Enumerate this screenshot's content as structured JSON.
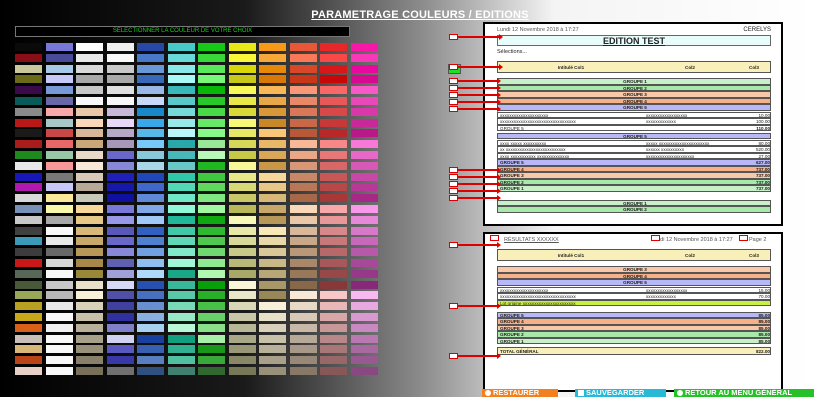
{
  "page": {
    "title": "PARAMETRAGE COULEURS / EDITIONS",
    "select_label": "SELECTIONNER LA COULEUR DE VOTRE CHOIX"
  },
  "palette": [
    [
      "#0a0a0a",
      "#8a0e18",
      "#c8c89a",
      "#6a6a18",
      "#3a0a4a",
      "#0a5a5a",
      "#8a8a8a",
      "#b81818",
      "#1a1a1a",
      "#a81c1c",
      "#1e8a1e",
      "#e8e8e8",
      "#1818b8",
      "#b018b0",
      "#d8d8d8",
      "#7890b8",
      "#c8c8c8",
      "#404040",
      "#3a9ab8",
      "#3c3c3c",
      "#c81818",
      "#586858",
      "#485838",
      "#98a858",
      "#b8a020",
      "#c8a818",
      "#d86018",
      "#c8c0b8",
      "#d8b878",
      "#b84418",
      "#e8d0c8"
    ],
    [
      "#7878d8",
      "#4a4a9a",
      "#a8c8e8",
      "#c8c8f8",
      "#7898d8",
      "#6868a8",
      "#f8a8a8",
      "#a8c8c8",
      "#c84848",
      "#e86868",
      "#98c8a8",
      "#f89898",
      "#787878",
      "#c8c8f8",
      "#f8e898",
      "#f8f8a8",
      "#a8a8a8",
      "#f8f8f8",
      "#e8e8e8",
      "#686868",
      "#d8d8d8",
      "#f8f8f8",
      "#c8c8c8",
      "#b8b8b8",
      "#e8e8e8",
      "#f8f8f8",
      "#f0f0f0",
      "#f8f8f8",
      "#f8f8f8",
      "#f8f8f8",
      "#f8f8f8"
    ],
    [
      "#ffffff",
      "#e8e8e8",
      "#d8d8d8",
      "#a8a8a8",
      "#c8c8c8",
      "#f8f8f8",
      "#e8c8a8",
      "#f8d8b8",
      "#d8b898",
      "#c8a878",
      "#e8d8c8",
      "#f8e8d8",
      "#d8c8b8",
      "#b8a898",
      "#c8c8b8",
      "#f8d898",
      "#e8c888",
      "#d8b878",
      "#c8a868",
      "#b89858",
      "#a88848",
      "#988838",
      "#e8e0c8",
      "#f8f0d8",
      "#d8d0b8",
      "#c8c0a8",
      "#b8b098",
      "#a8a088",
      "#989078",
      "#888068",
      "#787058"
    ],
    [
      "#f0f0f0",
      "#f8f8f8",
      "#c8c8c8",
      "#a8a8a8",
      "#e0e0e0",
      "#f8f8f8",
      "#c8b8d8",
      "#e8d8f8",
      "#b8a8c8",
      "#a898b8",
      "#6868c8",
      "#8888d8",
      "#2020b8",
      "#1818a8",
      "#1010a0",
      "#7878d8",
      "#9898e8",
      "#5858b8",
      "#6868c8",
      "#8888d8",
      "#6060b0",
      "#a0a0d8",
      "#d8d8f8",
      "#5050a8",
      "#4040a0",
      "#3030a0",
      "#8080c8",
      "#d0d0f0",
      "#5858c0",
      "#3838a8",
      "#707070"
    ],
    [
      "#2848a8",
      "#4878c8",
      "#6898d8",
      "#3868b8",
      "#98b8e8",
      "#c8d8f8",
      "#1888c8",
      "#38a8e8",
      "#58b8e8",
      "#78c8f8",
      "#88c8d8",
      "#a8d8e8",
      "#2048b8",
      "#4068c8",
      "#6088d8",
      "#80a8e8",
      "#a0c8f8",
      "#3060c0",
      "#5080d0",
      "#70a0e0",
      "#90c0f0",
      "#b0d8f8",
      "#2850b0",
      "#4870c0",
      "#6890d0",
      "#88b0e0",
      "#a8d0f0",
      "#1840a0",
      "#3860b0",
      "#5880c0",
      "#305080"
    ],
    [
      "#48c8c8",
      "#68d8d8",
      "#88e8e8",
      "#a8f8f8",
      "#38b8b8",
      "#58c8c8",
      "#78d8d8",
      "#98e8e8",
      "#b8f8f8",
      "#28a8a8",
      "#48b8b8",
      "#68c8c8",
      "#30c8a8",
      "#50d8b8",
      "#70e8c8",
      "#90f8d8",
      "#20b898",
      "#40c8a8",
      "#60d8b8",
      "#80e8c8",
      "#a0f8d8",
      "#18a888",
      "#38b898",
      "#58c8a8",
      "#78d8b8",
      "#98e8c8",
      "#b8f8d8",
      "#10a080",
      "#30b090",
      "#50c0a0",
      "#408070"
    ],
    [
      "#18c818",
      "#38d838",
      "#58e858",
      "#78f878",
      "#08b808",
      "#28c828",
      "#48d848",
      "#68e868",
      "#88f888",
      "#98e898",
      "#b8f8b8",
      "#20b820",
      "#40c840",
      "#60d860",
      "#80e880",
      "#a0f8a0",
      "#10a810",
      "#30b830",
      "#50c850",
      "#70d870",
      "#90e890",
      "#b0f8b0",
      "#08a008",
      "#28b028",
      "#48c048",
      "#68d068",
      "#88e088",
      "#a8f0a8",
      "#189818",
      "#38a838",
      "#306830"
    ],
    [
      "#e8e818",
      "#f8f838",
      "#d8d808",
      "#c8c818",
      "#f8f858",
      "#e8e848",
      "#d8d838",
      "#f8f878",
      "#e8e868",
      "#d8d858",
      "#c8c848",
      "#f8f898",
      "#e8e888",
      "#d8d878",
      "#c8c868",
      "#b8b858",
      "#f8f8b8",
      "#e8e8a8",
      "#d8d898",
      "#c8c888",
      "#b8b878",
      "#a8a868",
      "#f8f8d8",
      "#e8e8c8",
      "#d8d8b8",
      "#c8c8a8",
      "#b8b898",
      "#a8a888",
      "#989878",
      "#888868",
      "#787858"
    ],
    [
      "#f89818",
      "#f8a838",
      "#e88808",
      "#d87808",
      "#f8b858",
      "#e8a848",
      "#d89838",
      "#c88828",
      "#f8c878",
      "#e8b868",
      "#d8a858",
      "#c89848",
      "#f8d898",
      "#e8c888",
      "#d8b878",
      "#c8a868",
      "#b89858",
      "#f8e8b8",
      "#e8d8a8",
      "#d8c898",
      "#c8b888",
      "#b8a878",
      "#a89868",
      "#988858",
      "#f8f0d8",
      "#e8e0c8",
      "#d8d0b8",
      "#c8c0a8",
      "#b8b098",
      "#a8a088",
      "#989078"
    ],
    [
      "#e85838",
      "#f87858",
      "#d84828",
      "#c83818",
      "#f89878",
      "#e88868",
      "#d87858",
      "#c86848",
      "#b85838",
      "#f8b898",
      "#e8a888",
      "#d89878",
      "#c88868",
      "#b87858",
      "#a86848",
      "#f8d8b8",
      "#e8c8a8",
      "#d8b898",
      "#c8a888",
      "#b89878",
      "#a88868",
      "#987858",
      "#886848",
      "#f8e8d8",
      "#e8d8c8",
      "#d8c8b8",
      "#c8b8a8",
      "#b8a898",
      "#a89888",
      "#988878",
      "#887868"
    ],
    [
      "#e82828",
      "#f84848",
      "#d81818",
      "#c80808",
      "#f86868",
      "#e85858",
      "#d84848",
      "#c83838",
      "#b82828",
      "#f88888",
      "#e87878",
      "#d86868",
      "#c85858",
      "#b84848",
      "#a83838",
      "#f8a8a8",
      "#e89898",
      "#d88888",
      "#c87878",
      "#b86868",
      "#a85858",
      "#984848",
      "#883838",
      "#f8c8c8",
      "#e8b8b8",
      "#d8a8a8",
      "#c89898",
      "#b88888",
      "#a87878",
      "#986868",
      "#885858"
    ],
    [
      "#f818a8",
      "#f838b8",
      "#e808a0",
      "#d80890",
      "#f858c8",
      "#e848b8",
      "#d838a8",
      "#c82898",
      "#b81888",
      "#f878d8",
      "#e868c8",
      "#d858b8",
      "#c848a8",
      "#b83898",
      "#a82888",
      "#f898e8",
      "#e888d8",
      "#d878c8",
      "#c868b8",
      "#b858a8",
      "#a84898",
      "#983888",
      "#882878",
      "#f8b8f0",
      "#e8a8e0",
      "#d898d0",
      "#c888c0",
      "#b878b0",
      "#a868a0",
      "#985890",
      "#884880"
    ]
  ],
  "report1": {
    "date": "Lundi 12 Novembre 2018 à 17:27",
    "company": "CERELYS",
    "title": "EDITION TEST",
    "selections": "Sélections...",
    "col1": "Intitulé Col1",
    "col2": "Col2",
    "col3": "Col3",
    "groups_top": [
      "GROUPE 1",
      "GROUPE 2",
      "GROUPE 3",
      "GROUPE 4",
      "GROUPE 5"
    ],
    "lines_a": [
      [
        "xxxxxxxxxxxxxxxxxxxxx",
        "xxxxxxxxxxxxxxxxxx",
        "10.00"
      ],
      [
        "xxxxxxxxxxxxxxxxxxxxxxxxxxxxxxxxx",
        "xxxxxxxxxxxxx",
        "100.00"
      ]
    ],
    "subtotal_a": [
      "GROUPE 5",
      "",
      "110.00"
    ],
    "group_mid": "GROUPE 5",
    "lines_b": [
      [
        "xxxx xxxxx xxxxxxxxxx",
        "xxxxx xxxxxxxxxxxxxxxxxxxxxx",
        "80.00"
      ],
      [
        "xx xxxxxxxxxxxxxxxxxxxxxxxxxx",
        "xxxxxx xxxxxxxxxx",
        "520.00"
      ],
      [
        "xxxx xxxxxxxxxxx xxxxxxxxxxxxxx",
        "xxxxxxxxxxxxxxxxxxxxx",
        "27.00"
      ]
    ],
    "totals": [
      [
        "GROUPE 5",
        "627.00"
      ],
      [
        "GROUPE 4",
        "737.00"
      ],
      [
        "GROUPE 3",
        "737.00"
      ],
      [
        "GROUPE 2",
        "737.00"
      ],
      [
        "GROUPE 1",
        "737.00"
      ]
    ],
    "groups_bottom": [
      "GROUPE 1",
      "GROUPE 2"
    ]
  },
  "report2": {
    "header_left": "RÉSULTATS XXXXXX",
    "date": "Lundi 12 Novembre 2018 à 17:27",
    "page": "Page 2",
    "col1": "Intitulé Col1",
    "col2": "Col2",
    "col3": "Col3",
    "groups": [
      "GROUPE 3",
      "GROUPE 4",
      "GROUPE 5"
    ],
    "lines": [
      [
        "xxxxxxxxxxxxxxxxxxxxx",
        "xxxxxxxxxxxxxxxxxx",
        "15.00"
      ],
      [
        "xxxxxxxxxxxxxxxxxxxxxxxxxxxxxxxxx",
        "xxxxxxxxxxxxx",
        "70.00"
      ]
    ],
    "lot_label": "Lot origine xxxxxxxxxxxxxxxxxxxxxxx",
    "totals": [
      [
        "GROUPE 5",
        "85.00"
      ],
      [
        "GROUPE 4",
        "85.00"
      ],
      [
        "GROUPE 3",
        "85.00"
      ],
      [
        "GROUPE 2",
        "85.00"
      ],
      [
        "GROUPE 1",
        "85.00"
      ]
    ],
    "grand_total": [
      "TOTAL GÉNÉRAL",
      "822.00"
    ]
  },
  "colors": {
    "g1": "#c8f0c8",
    "g2": "#a8e8a8",
    "g3": "#f8c8a8",
    "g4": "#f8b088",
    "g5": "#b8b8f8",
    "header": "#f8f0b8",
    "lot": "#c8f040",
    "title_bg": "#e8fcfc"
  },
  "buttons": {
    "restore": "RESTAURER",
    "save": "SAUVEGARDER",
    "back": "RETOUR AU MENU GÉNÉRAL",
    "restore_color": "#f08020",
    "save_color": "#28b8d8",
    "back_color": "#28c028"
  }
}
